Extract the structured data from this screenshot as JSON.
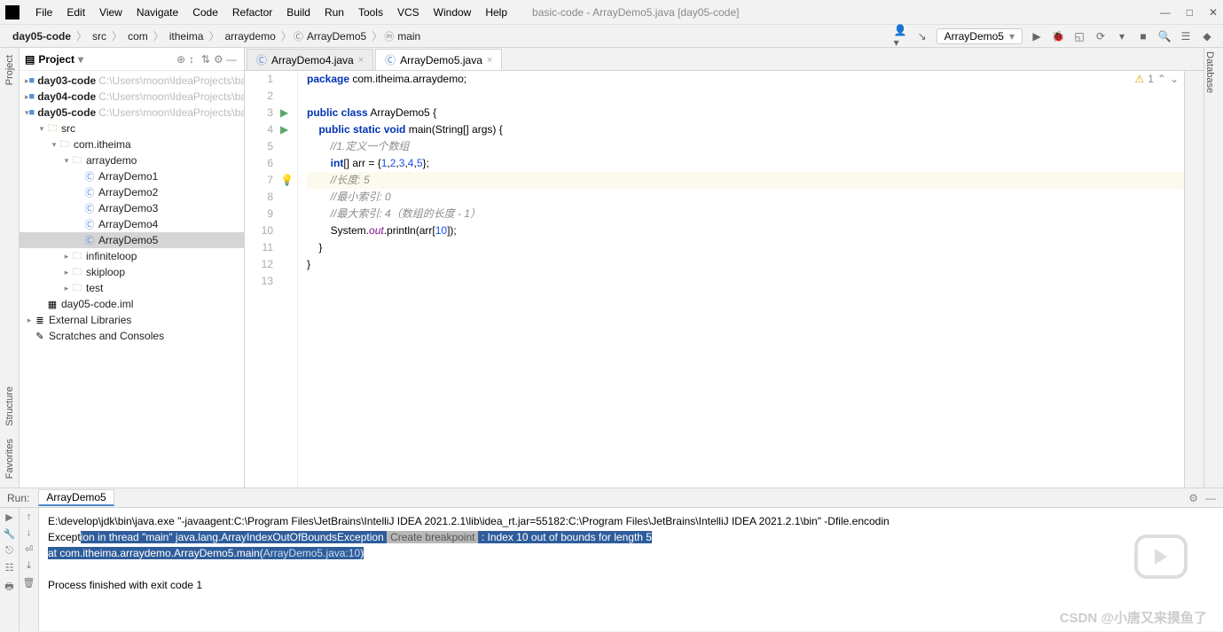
{
  "window": {
    "title": "basic-code - ArrayDemo5.java [day05-code]"
  },
  "menu": [
    "File",
    "Edit",
    "View",
    "Navigate",
    "Code",
    "Refactor",
    "Build",
    "Run",
    "Tools",
    "VCS",
    "Window",
    "Help"
  ],
  "breadcrumbs": {
    "root": "day05-code",
    "parts": [
      "src",
      "com",
      "itheima",
      "arraydemo"
    ],
    "cls": "ArrayDemo5",
    "meth": "main"
  },
  "runconfig": {
    "name": "ArrayDemo5"
  },
  "project": {
    "title": "Project",
    "modules": [
      {
        "name": "day03-code",
        "path": "C:\\Users\\moon\\IdeaProjects\\basic-code"
      },
      {
        "name": "day04-code",
        "path": "C:\\Users\\moon\\IdeaProjects\\basic-code"
      },
      {
        "name": "day05-code",
        "path": "C:\\Users\\moon\\IdeaProjects\\basic-code"
      }
    ],
    "srcFolder": "src",
    "pkg1": "com.itheima",
    "pkg2": "arraydemo",
    "classes": [
      "ArrayDemo1",
      "ArrayDemo2",
      "ArrayDemo3",
      "ArrayDemo4",
      "ArrayDemo5"
    ],
    "otherPkgs": [
      "infiniteloop",
      "skiploop",
      "test"
    ],
    "iml": "day05-code.iml",
    "ext": "External Libraries",
    "scratch": "Scratches and Consoles"
  },
  "tabs": [
    {
      "name": "ArrayDemo4.java",
      "active": false
    },
    {
      "name": "ArrayDemo5.java",
      "active": true
    }
  ],
  "editor": {
    "warn": "1",
    "lines": [
      {
        "n": 1,
        "html": "<span class='kw'>package</span> com.itheima.arraydemo;"
      },
      {
        "n": 2,
        "html": ""
      },
      {
        "n": 3,
        "run": true,
        "html": "<span class='kw'>public class</span> <span class='clsnm'>ArrayDemo5</span> {"
      },
      {
        "n": 4,
        "run": true,
        "html": "    <span class='kw'>public static void</span> main(String[] args) {"
      },
      {
        "n": 5,
        "html": "        <span class='cmt'>//1.定义一个数组</span>"
      },
      {
        "n": 6,
        "html": "        <span class='kw'>int</span>[] arr = {<span class='num'>1</span>,<span class='num'>2</span>,<span class='num'>3</span>,<span class='num'>4</span>,<span class='num'>5</span>};"
      },
      {
        "n": 7,
        "bulb": true,
        "hl": true,
        "html": "        <span class='cmt'>//长度: 5</span>"
      },
      {
        "n": 8,
        "html": "        <span class='cmt'>//最小索引: 0</span>"
      },
      {
        "n": 9,
        "html": "        <span class='cmt'>//最大索引: 4（数组的长度 - 1）</span>"
      },
      {
        "n": 10,
        "html": "        System.<span class='fld'>out</span>.println(arr[<span class='num'>10</span>]);"
      },
      {
        "n": 11,
        "html": "    }"
      },
      {
        "n": 12,
        "html": "}"
      },
      {
        "n": 13,
        "html": ""
      }
    ]
  },
  "run": {
    "label": "Run:",
    "tab": "ArrayDemo5",
    "cmd": "E:\\develop\\jdk\\bin\\java.exe \"-javaagent:C:\\Program Files\\JetBrains\\IntelliJ IDEA 2021.2.1\\lib\\idea_rt.jar=55182:C:\\Program Files\\JetBrains\\IntelliJ IDEA 2021.2.1\\bin\" -Dfile.encodin",
    "ex_pre": "Except",
    "ex_mid": "ion in thread \"main\" java.lang.ArrayIndexOutOfBoundsException",
    "ex_bp": "Create breakpoint",
    "ex_post": ": Index 10 out of bounds for length 5",
    "stack_pre": "    at com.itheima.arraydemo.ArrayDemo5.main(",
    "stack_lnk": "ArrayDemo5.java:10",
    "stack_post": ")",
    "exit": "Process finished with exit code 1"
  },
  "watermark": "CSDN @小唐又来摸鱼了"
}
